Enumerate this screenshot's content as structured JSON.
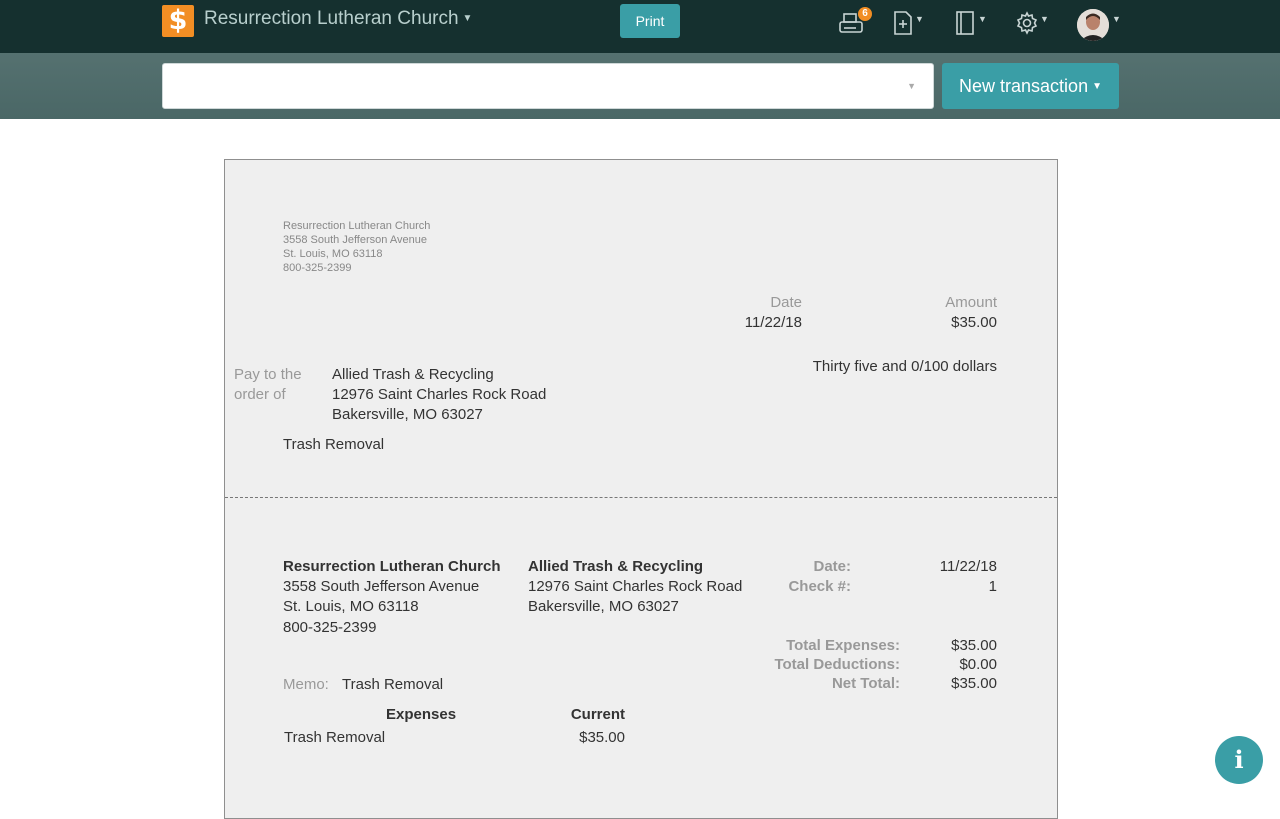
{
  "header": {
    "logo_glyph": "$",
    "org_name": "Resurrection Lutheran Church",
    "print_label": "Print",
    "print_badge": "6",
    "icons": [
      "printer-icon",
      "new-document-icon",
      "ledger-book-icon",
      "settings-gear-icon",
      "user-avatar"
    ]
  },
  "toolbar": {
    "search_value": "",
    "new_transaction_label": "New transaction"
  },
  "check": {
    "payer": {
      "name": "Resurrection Lutheran Church",
      "address1": "3558 South Jefferson Avenue",
      "address2": "St. Louis, MO 63118",
      "phone": "800-325-2399"
    },
    "date_label": "Date",
    "date": "11/22/18",
    "amount_label": "Amount",
    "amount": "$35.00",
    "amount_words": "Thirty five and 0/100 dollars",
    "pay_to_label_1": "Pay to the",
    "pay_to_label_2": "order of",
    "payee": {
      "name": "Allied Trash & Recycling",
      "address1": "12976 Saint Charles Rock Road",
      "address2": "Bakersville, MO 63027"
    },
    "memo": "Trash Removal"
  },
  "stub": {
    "payer": {
      "name": "Resurrection Lutheran Church",
      "address1": "3558 South Jefferson Avenue",
      "address2": "St. Louis, MO 63118",
      "phone": "800-325-2399"
    },
    "payee": {
      "name": "Allied Trash & Recycling",
      "address1": "12976 Saint Charles Rock Road",
      "address2": "Bakersville, MO 63027"
    },
    "date_label": "Date:",
    "date": "11/22/18",
    "check_no_label": "Check #:",
    "check_no": "1",
    "total_expenses_label": "Total Expenses:",
    "total_expenses": "$35.00",
    "total_deductions_label": "Total Deductions:",
    "total_deductions": "$0.00",
    "net_total_label": "Net Total:",
    "net_total": "$35.00",
    "memo_label": "Memo:",
    "memo": "Trash Removal",
    "table": {
      "headers": [
        "Expenses",
        "Current"
      ],
      "rows": [
        [
          "Trash Removal",
          "$35.00"
        ]
      ]
    }
  },
  "colors": {
    "nav_bg": "#15302f",
    "accent": "#3a9ea6",
    "logo": "#f28e24"
  }
}
